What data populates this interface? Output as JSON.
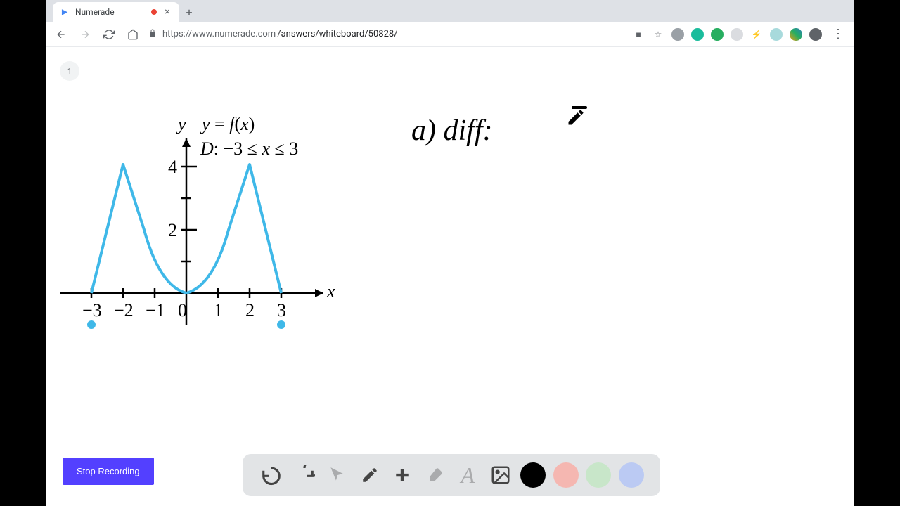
{
  "tab": {
    "title": "Numerade",
    "recording": true
  },
  "url": {
    "secure": true,
    "host": "https://www.numerade.com",
    "path": "/answers/whiteboard/50828/"
  },
  "page": {
    "indicator": "1"
  },
  "graph": {
    "y_label": "y",
    "fx_label": "y = f(x)",
    "domain_label": "D: −3 ≤ x ≤ 3",
    "x_label": "x",
    "x_ticks": [
      "−3",
      "−2",
      "−1",
      "0",
      "1",
      "2",
      "3"
    ],
    "y_ticks": [
      "2",
      "4"
    ]
  },
  "chart_data": {
    "type": "line",
    "title": "y = f(x)",
    "xlabel": "x",
    "ylabel": "y",
    "xlim": [
      -3.5,
      3.5
    ],
    "ylim": [
      0,
      4.5
    ],
    "domain": "−3 ≤ x ≤ 3",
    "x_tick_labels": [
      "−3",
      "−2",
      "−1",
      "0",
      "1",
      "2",
      "3"
    ],
    "y_tick_labels": [
      "2",
      "4"
    ],
    "series": [
      {
        "name": "f(x)",
        "x": [
          -3,
          -2,
          -1.5,
          -1,
          -0.5,
          0,
          0.5,
          1,
          1.5,
          2,
          3
        ],
        "values": [
          0,
          4,
          2,
          0.6,
          0.15,
          0,
          0.15,
          0.6,
          2,
          4,
          0
        ]
      }
    ],
    "endpoints": [
      {
        "x": -3,
        "y": 0,
        "closed": true
      },
      {
        "x": 3,
        "y": 0,
        "closed": true
      }
    ],
    "notes": "Two sharp peaks at x=-2 and x=2 (height ~4); smooth minimum at x=0 (height 0)."
  },
  "handwriting": {
    "text": "a) diff:"
  },
  "buttons": {
    "stop": "Stop Recording"
  },
  "toolbar": {
    "undo": "undo",
    "redo": "redo",
    "pointer": "pointer",
    "pen": "pen",
    "add": "add",
    "eraser": "eraser",
    "text": "text",
    "image": "image",
    "colors": {
      "black": "#000000",
      "red": "#f5b7b1",
      "green": "#c8e6c9",
      "blue": "#bbcaf3"
    }
  }
}
